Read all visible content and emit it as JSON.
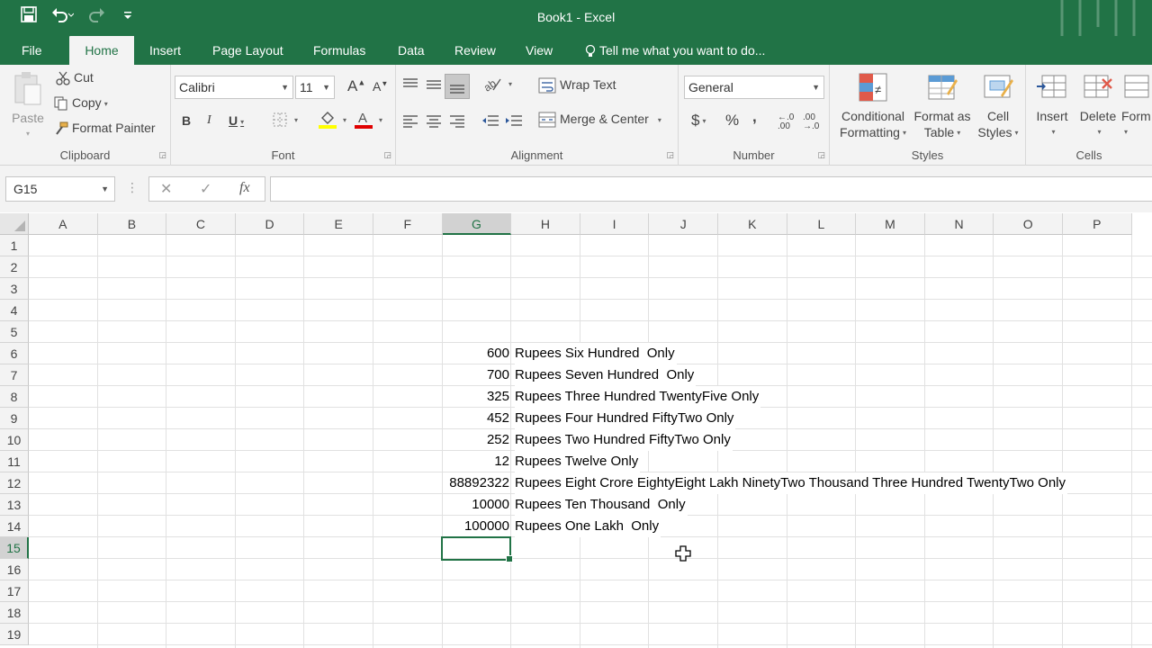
{
  "window": {
    "title": "Book1  -  Excel"
  },
  "quick_access": {
    "save_icon": "save-icon",
    "undo_icon": "undo-icon",
    "redo_icon": "redo-icon",
    "customize_icon": "customize-qat-icon"
  },
  "tabs": [
    "File",
    "Home",
    "Insert",
    "Page Layout",
    "Formulas",
    "Data",
    "Review",
    "View"
  ],
  "tell_me": "Tell me what you want to do...",
  "ribbon": {
    "clipboard": {
      "paste": "Paste",
      "cut": "Cut",
      "copy": "Copy",
      "format_painter": "Format Painter",
      "label": "Clipboard"
    },
    "font": {
      "family": "Calibri",
      "size": "11",
      "bold": "B",
      "italic": "I",
      "underline": "U",
      "label": "Font",
      "grow": "A",
      "shrink": "A"
    },
    "alignment": {
      "wrap_text": "Wrap Text",
      "merge_center": "Merge & Center",
      "label": "Alignment"
    },
    "number": {
      "format": "General",
      "currency": "$",
      "percent": "%",
      "comma": ",",
      "inc_decimal": "←.0 .00",
      "dec_decimal": ".00 →.0",
      "label": "Number"
    },
    "styles": {
      "conditional_1": "Conditional",
      "conditional_2": "Formatting",
      "table_1": "Format as",
      "table_2": "Table",
      "cell_1": "Cell",
      "cell_2": "Styles",
      "label": "Styles"
    },
    "cells": {
      "insert": "Insert",
      "delete": "Delete",
      "format": "Form",
      "label": "Cells"
    }
  },
  "formula_bar": {
    "name_box": "G15",
    "cancel": "✕",
    "enter": "✓",
    "fx": "fx",
    "value": ""
  },
  "columns": [
    "A",
    "B",
    "C",
    "D",
    "E",
    "F",
    "G",
    "H",
    "I",
    "J",
    "K",
    "L",
    "M",
    "N",
    "O",
    "P"
  ],
  "rows": [
    "1",
    "2",
    "3",
    "4",
    "5",
    "6",
    "7",
    "8",
    "9",
    "10",
    "11",
    "12",
    "13",
    "14",
    "15",
    "16",
    "17",
    "18",
    "19"
  ],
  "selected": {
    "column": "G",
    "row": "15"
  },
  "cells": [
    {
      "row": "6",
      "g": "600",
      "h": "Rupees Six Hundred  Only"
    },
    {
      "row": "7",
      "g": "700",
      "h": "Rupees Seven Hundred  Only"
    },
    {
      "row": "8",
      "g": "325",
      "h": "Rupees Three Hundred TwentyFive Only"
    },
    {
      "row": "9",
      "g": "452",
      "h": "Rupees Four Hundred FiftyTwo Only"
    },
    {
      "row": "10",
      "g": "252",
      "h": "Rupees Two Hundred FiftyTwo Only"
    },
    {
      "row": "11",
      "g": "12",
      "h": "Rupees Twelve Only"
    },
    {
      "row": "12",
      "g": "88892322",
      "h": "Rupees Eight Crore EightyEight Lakh NinetyTwo Thousand Three Hundred TwentyTwo Only"
    },
    {
      "row": "13",
      "g": "10000",
      "h": "Rupees Ten Thousand  Only"
    },
    {
      "row": "14",
      "g": "100000",
      "h": "Rupees One Lakh  Only"
    }
  ],
  "colors": {
    "accent": "#217346",
    "ribbon_bg": "#f3f3f3",
    "grid_line": "#e1e1e1"
  }
}
